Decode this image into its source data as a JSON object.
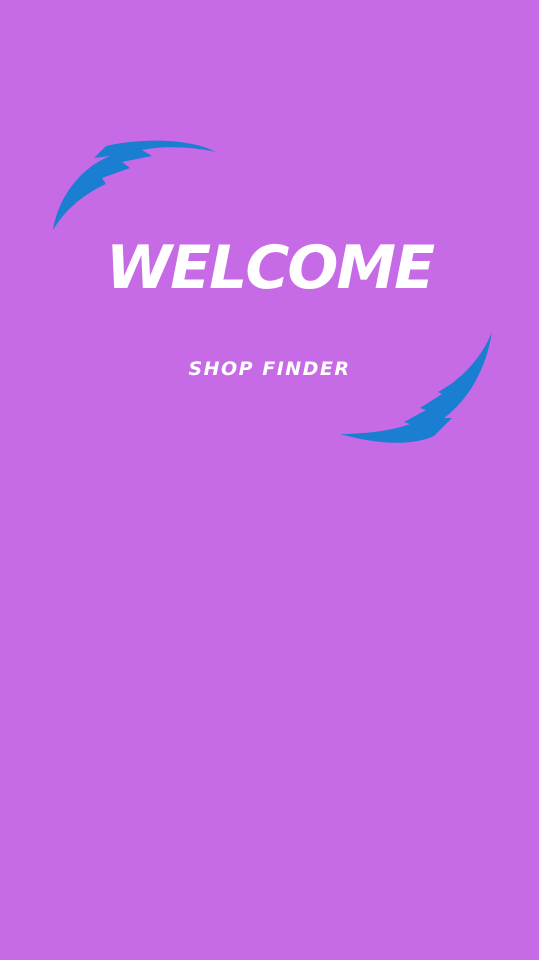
{
  "splash": {
    "title": "WELCOME",
    "subtitle": "SHOP FINDER"
  },
  "icons": {
    "top": "lightning-swoosh-icon",
    "bottom": "lightning-swoosh-icon"
  },
  "colors": {
    "background": "#c76ae6",
    "accent": "#1a7fd0",
    "text": "#ffffff"
  }
}
